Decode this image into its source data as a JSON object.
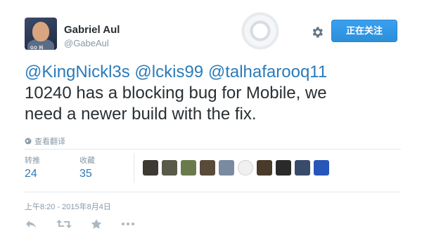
{
  "user": {
    "name": "Gabriel Aul",
    "handle": "@GabeAul",
    "avatar_tag": "GO 抖"
  },
  "follow_button": {
    "label": "正在关注"
  },
  "tweet": {
    "mentions": [
      "@KingNickl3s",
      "@lckis99",
      "@talhafarooq11"
    ],
    "line2": "10240 has a blocking bug for Mobile, we",
    "line3": "need a newer build with the fix."
  },
  "translate": {
    "label": "查看翻译",
    "icon": "globe-icon"
  },
  "stats": {
    "retweets": {
      "label": "转推",
      "value": "24"
    },
    "favorites": {
      "label": "收藏",
      "value": "35"
    }
  },
  "favoriters": {
    "count": 10,
    "colors": [
      "#3d3a33",
      "#5a5a4a",
      "#6b7a4c",
      "#5a4a3a",
      "#7a8aa0",
      "#f0f0f0",
      "#4a3a2a",
      "#2a2a2a",
      "#3a4a6a",
      "#2856b8"
    ]
  },
  "timestamp": "上午8:20 - 2015年8月4日",
  "actions": [
    "reply-icon",
    "retweet-icon",
    "favorite-icon",
    "more-icon"
  ],
  "colors": {
    "accent": "#2b7bb9",
    "button": "#2b8fd9",
    "muted": "#8899a6"
  }
}
